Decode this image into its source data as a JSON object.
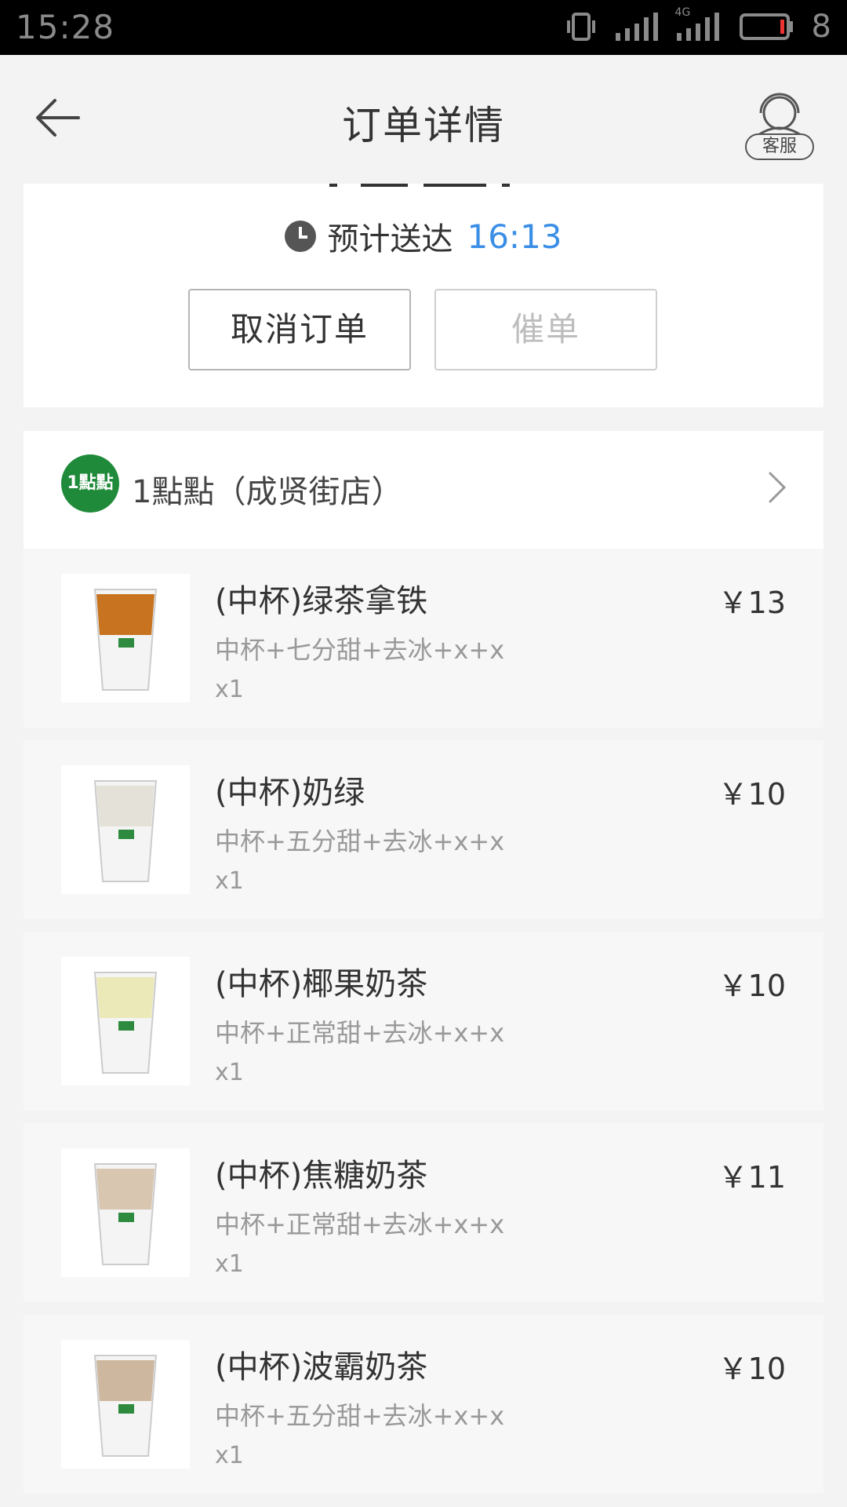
{
  "status_bar": {
    "time": "15:28",
    "network": "4G",
    "battery": "8"
  },
  "header": {
    "title": "订单详情",
    "service_label": "客服"
  },
  "order_status": {
    "eta_label": "预计送达",
    "eta_time": "16:13",
    "cancel_label": "取消订单",
    "urge_label": "催单"
  },
  "shop": {
    "name": "1點點（成贤街店）",
    "logo_text": "1點點"
  },
  "items": [
    {
      "name": "(中杯)绿茶拿铁",
      "spec": "中杯+七分甜+去冰+x+x",
      "qty": "x1",
      "price": "￥13",
      "cup_color": "#c8731f"
    },
    {
      "name": "(中杯)奶绿",
      "spec": "中杯+五分甜+去冰+x+x",
      "qty": "x1",
      "price": "￥10",
      "cup_color": "#e4e2d8"
    },
    {
      "name": "(中杯)椰果奶茶",
      "spec": "中杯+正常甜+去冰+x+x",
      "qty": "x1",
      "price": "￥10",
      "cup_color": "#ece9b8"
    },
    {
      "name": "(中杯)焦糖奶茶",
      "spec": "中杯+正常甜+去冰+x+x",
      "qty": "x1",
      "price": "￥11",
      "cup_color": "#d8c6b0"
    },
    {
      "name": "(中杯)波霸奶茶",
      "spec": "中杯+五分甜+去冰+x+x",
      "qty": "x1",
      "price": "￥10",
      "cup_color": "#cdb79e"
    }
  ],
  "colors": {
    "accent": "#3a8ee6",
    "shop_logo": "#1f8a3a"
  }
}
